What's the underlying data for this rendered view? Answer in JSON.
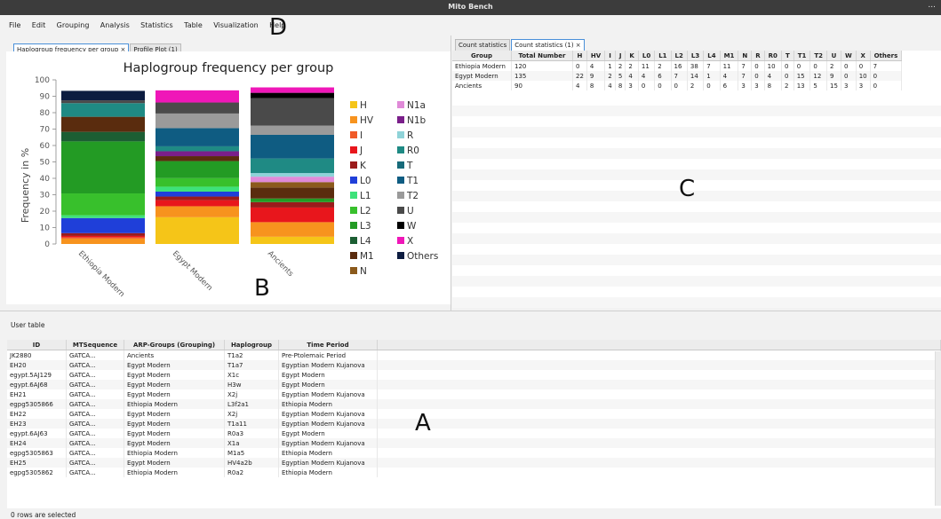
{
  "window": {
    "title": "Mito Bench",
    "controls": "..."
  },
  "menu": [
    "File",
    "Edit",
    "Grouping",
    "Analysis",
    "Statistics",
    "Table",
    "Visualization",
    "Help"
  ],
  "markers": {
    "a": "A",
    "b": "B",
    "c": "C",
    "d": "D"
  },
  "left_tabs": [
    {
      "label": "Haplogroup frequency per group ×",
      "active": true
    },
    {
      "label": "Profile Plot (1)",
      "active": false
    }
  ],
  "right_tabs": [
    {
      "label": "Count statistics",
      "active": false
    },
    {
      "label": "Count statistics (1) ×",
      "active": true
    }
  ],
  "colors": {
    "H": "#f5c518",
    "HV": "#f7931e",
    "I": "#f05a28",
    "J": "#e8161c",
    "K": "#9b1b1b",
    "L0": "#1f3fd9",
    "L1": "#3de27a",
    "L2": "#38c02c",
    "L3": "#239b24",
    "L4": "#1c5e33",
    "M1": "#5a2c0e",
    "N": "#8b5a1c",
    "N1a": "#e08ad8",
    "N1b": "#7a1f8a",
    "R": "#8fd3d8",
    "R0": "#1f8a84",
    "T": "#176b7a",
    "T1": "#0f5c82",
    "T2": "#9a9a9a",
    "U": "#4a4a4a",
    "W": "#000000",
    "X": "#ef17b8",
    "Others": "#0c1c40"
  },
  "chart_data": {
    "type": "bar",
    "stacked": true,
    "title": "Haplogroup frequency per group",
    "xlabel": "",
    "ylabel": "Frequency in %",
    "ylim": [
      0,
      100
    ],
    "yticks": [
      0,
      10,
      20,
      30,
      40,
      50,
      60,
      70,
      80,
      90,
      100
    ],
    "categories": [
      "Ethiopia Modern",
      "Egypt Modern",
      "Ancients"
    ],
    "legend_placement": "right",
    "legend": [
      "H",
      "HV",
      "I",
      "J",
      "K",
      "L0",
      "L1",
      "L2",
      "L3",
      "L4",
      "M1",
      "N",
      "N1a",
      "N1b",
      "R",
      "R0",
      "T",
      "T1",
      "T2",
      "U",
      "W",
      "X",
      "Others"
    ],
    "series": [
      {
        "name": "H",
        "values": [
          0,
          16.3,
          4.4
        ]
      },
      {
        "name": "HV",
        "values": [
          3.3,
          6.7,
          8.9
        ]
      },
      {
        "name": "I",
        "values": [
          0.8,
          0,
          0
        ]
      },
      {
        "name": "J",
        "values": [
          0.8,
          3.7,
          8.9
        ]
      },
      {
        "name": "K",
        "values": [
          1.7,
          2.2,
          3.3
        ]
      },
      {
        "name": "L0",
        "values": [
          9.2,
          3.0,
          0
        ]
      },
      {
        "name": "L1",
        "values": [
          1.7,
          3.0,
          0
        ]
      },
      {
        "name": "L2",
        "values": [
          13.3,
          5.2,
          0
        ]
      },
      {
        "name": "L3",
        "values": [
          31.7,
          10.4,
          2.2
        ]
      },
      {
        "name": "L4",
        "values": [
          5.8,
          0,
          0
        ]
      },
      {
        "name": "M1",
        "values": [
          9.2,
          3.0,
          6.7
        ]
      },
      {
        "name": "N",
        "values": [
          0,
          0,
          3.3
        ]
      },
      {
        "name": "N1a",
        "values": [
          0,
          0,
          3.3
        ]
      },
      {
        "name": "N1b",
        "values": [
          0,
          3.0,
          0
        ]
      },
      {
        "name": "R",
        "values": [
          0,
          0,
          2.2
        ]
      },
      {
        "name": "R0",
        "values": [
          8.3,
          3.0,
          8.9
        ]
      },
      {
        "name": "T",
        "values": [
          0,
          0,
          0
        ]
      },
      {
        "name": "T1",
        "values": [
          0,
          11.1,
          14.4
        ]
      },
      {
        "name": "T2",
        "values": [
          0,
          8.9,
          5.6
        ]
      },
      {
        "name": "U",
        "values": [
          1.7,
          6.7,
          16.7
        ]
      },
      {
        "name": "W",
        "values": [
          0,
          0,
          3.3
        ]
      },
      {
        "name": "X",
        "values": [
          0,
          7.4,
          3.3
        ]
      },
      {
        "name": "Others",
        "values": [
          5.8,
          0,
          0
        ]
      }
    ]
  },
  "count_table": {
    "headers": [
      "Group",
      "Total Number",
      "H",
      "HV",
      "I",
      "J",
      "K",
      "L0",
      "L1",
      "L2",
      "L3",
      "L4",
      "M1",
      "N",
      "R",
      "R0",
      "T",
      "T1",
      "T2",
      "U",
      "W",
      "X",
      "Others"
    ],
    "rows": [
      [
        "Ethiopia Modern",
        "120",
        "0",
        "4",
        "1",
        "2",
        "2",
        "11",
        "2",
        "16",
        "38",
        "7",
        "11",
        "7",
        "0",
        "10",
        "0",
        "0",
        "0",
        "2",
        "0",
        "0",
        "7"
      ],
      [
        "Egypt Modern",
        "135",
        "22",
        "9",
        "2",
        "5",
        "4",
        "4",
        "6",
        "7",
        "14",
        "1",
        "4",
        "7",
        "0",
        "4",
        "0",
        "15",
        "12",
        "9",
        "0",
        "10",
        "0"
      ],
      [
        "Ancients",
        "90",
        "4",
        "8",
        "4",
        "8",
        "3",
        "0",
        "0",
        "0",
        "2",
        "0",
        "6",
        "3",
        "3",
        "8",
        "2",
        "13",
        "5",
        "15",
        "3",
        "3",
        "0"
      ]
    ]
  },
  "user_table": {
    "label": "User table",
    "headers": [
      "ID",
      "MTSequence",
      "ARP-Groups (Grouping)",
      "Haplogroup",
      "Time Period"
    ],
    "rows": [
      [
        "JK2880",
        "GATCA...",
        "Ancients",
        "T1a2",
        "Pre-Ptolemaic Period"
      ],
      [
        "EH20",
        "GATCA...",
        "Egypt Modern",
        "T1a7",
        "Egyptian Modern Kujanova"
      ],
      [
        "egypt.5AJ129",
        "GATCA...",
        "Egypt Modern",
        "X1c",
        "Egypt Modern"
      ],
      [
        "egypt.6AJ68",
        "GATCA...",
        "Egypt Modern",
        "H3w",
        "Egypt Modern"
      ],
      [
        "EH21",
        "GATCA...",
        "Egypt Modern",
        "X2j",
        "Egyptian Modern Kujanova"
      ],
      [
        "egpg5305866",
        "GATCA...",
        "Ethiopia Modern",
        "L3f2a1",
        "Ethiopia Modern"
      ],
      [
        "EH22",
        "GATCA...",
        "Egypt Modern",
        "X2j",
        "Egyptian Modern Kujanova"
      ],
      [
        "EH23",
        "GATCA...",
        "Egypt Modern",
        "T1a11",
        "Egyptian Modern Kujanova"
      ],
      [
        "egypt.6AJ63",
        "GATCA...",
        "Egypt Modern",
        "R0a3",
        "Egypt Modern"
      ],
      [
        "EH24",
        "GATCA...",
        "Egypt Modern",
        "X1a",
        "Egyptian Modern Kujanova"
      ],
      [
        "egpg5305863",
        "GATCA...",
        "Ethiopia Modern",
        "M1a5",
        "Ethiopia Modern"
      ],
      [
        "EH25",
        "GATCA...",
        "Egypt Modern",
        "HV4a2b",
        "Egyptian Modern Kujanova"
      ],
      [
        "egpg5305862",
        "GATCA...",
        "Ethiopia Modern",
        "R0a2",
        "Ethiopia Modern"
      ]
    ]
  },
  "status": "0 rows are selected"
}
